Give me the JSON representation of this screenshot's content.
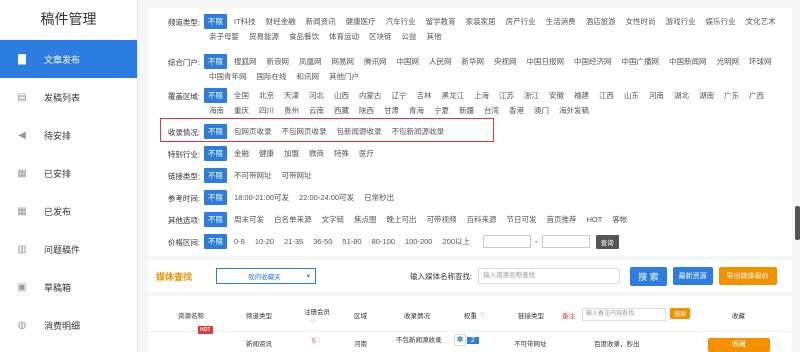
{
  "sidebar": {
    "title": "稿件管理",
    "items": [
      {
        "label": "文章发布",
        "icon": "document-icon",
        "glyph": "▇",
        "active": true
      },
      {
        "label": "发稿列表",
        "icon": "list-icon",
        "glyph": "▤",
        "active": false
      },
      {
        "label": "待安排",
        "icon": "megaphone-icon",
        "glyph": "◀",
        "active": false
      },
      {
        "label": "已安排",
        "icon": "edit-icon",
        "glyph": "▦",
        "active": false
      },
      {
        "label": "已发布",
        "icon": "published-icon",
        "glyph": "▦",
        "active": false
      },
      {
        "label": "问题稿件",
        "icon": "problem-icon",
        "glyph": "▥",
        "active": false
      },
      {
        "label": "草稿箱",
        "icon": "draft-icon",
        "glyph": "▣",
        "active": false
      },
      {
        "label": "消费明细",
        "icon": "coin-icon",
        "glyph": "◍",
        "active": false
      }
    ]
  },
  "filters": {
    "channel": {
      "label": "频道类型:",
      "options": [
        "不限",
        "IT科技",
        "财经金融",
        "新闻资讯",
        "健康医疗",
        "汽车行业",
        "留学教育",
        "家装家居",
        "房产行业",
        "生活消费",
        "酒店旅游",
        "女性时尚",
        "游戏行业",
        "娱乐行业",
        "文化艺术",
        "亲子母婴",
        "贸易能源",
        "食品餐饮",
        "体育运动",
        "区块链",
        "公益",
        "其他"
      ]
    },
    "portal": {
      "label": "综合门户:",
      "options": [
        "不限",
        "搜狐网",
        "新浪网",
        "凤凰网",
        "网易网",
        "腾讯网",
        "中国网",
        "人民网",
        "新华网",
        "央视网",
        "中国日报网",
        "中国经济网",
        "中国广播网",
        "中国新闻网",
        "光明网",
        "环球网",
        "中国青年网",
        "国际在线",
        "和讯网",
        "其他门户"
      ]
    },
    "region": {
      "label": "覆盖区域:",
      "options": [
        "不限",
        "全国",
        "北京",
        "天津",
        "河北",
        "山西",
        "内蒙古",
        "辽宁",
        "吉林",
        "黑龙江",
        "上海",
        "江苏",
        "浙江",
        "安徽",
        "福建",
        "江西",
        "山东",
        "河南",
        "湖北",
        "湖南",
        "广东",
        "广西",
        "海南",
        "重庆",
        "四川",
        "贵州",
        "云南",
        "西藏",
        "陕西",
        "甘肃",
        "青海",
        "宁夏",
        "新疆",
        "台湾",
        "香港",
        "澳门",
        "海外发稿"
      ]
    },
    "indexed": {
      "label": "收录情况:",
      "options": [
        "不限",
        "包网页收录",
        "不包网页收录",
        "包新闻源收录",
        "不包新闻源收录"
      ]
    },
    "special": {
      "label": "特别行业:",
      "options": [
        "不限",
        "金融",
        "健康",
        "加盟",
        "微商",
        "特殊",
        "医疗"
      ]
    },
    "link": {
      "label": "链接类型:",
      "options": [
        "不限",
        "不可带网址",
        "可带网址"
      ]
    },
    "reference_time": {
      "label": "参考时间:",
      "options": [
        "不限",
        "18:00-21:00可发",
        "22:00-24:00可发",
        "日常秒出"
      ]
    },
    "other": {
      "label": "其他选项:",
      "options": [
        "不限",
        "周末可发",
        "白名单来源",
        "文字链",
        "焦点图",
        "晚上可出",
        "可带视频",
        "百科来源",
        "节日可发",
        "首页推荐",
        "HOT",
        "客帐"
      ]
    },
    "price": {
      "label": "价格区间:",
      "options": [
        "不限",
        "0-9",
        "10-20",
        "21-35",
        "36-50",
        "51-80",
        "80-100",
        "100-200",
        "200以上"
      ],
      "dash": "-",
      "query": "查询"
    }
  },
  "search": {
    "media_title": "媒体查找",
    "fav_select": "我的收藏夹",
    "name_label": "输入媒体名称查找:",
    "name_placeholder": "输入资源名称查找",
    "search_btn": "搜 索",
    "latest_btn": "最新资源",
    "export_btn": "导出媒体报价"
  },
  "table": {
    "headers": [
      "资源名称",
      "频道类型",
      "注册会员",
      "区域",
      "收录情况",
      "权重",
      "链接类型",
      "备注",
      "收藏"
    ],
    "remark_placeholder": "输入备注内容查找",
    "remark_search": "搜索",
    "row": {
      "badge": "HOT",
      "channel": "新闻资讯",
      "price": "5",
      "region": "河南",
      "indexed": "不包新闻源收录",
      "weight": "2",
      "link": "不可带网址",
      "remark": "百度收录，秒出",
      "fav": "收藏"
    }
  },
  "colors": {
    "accent": "#2d7de0",
    "orange": "#f29100",
    "highlight": "#e53935"
  }
}
